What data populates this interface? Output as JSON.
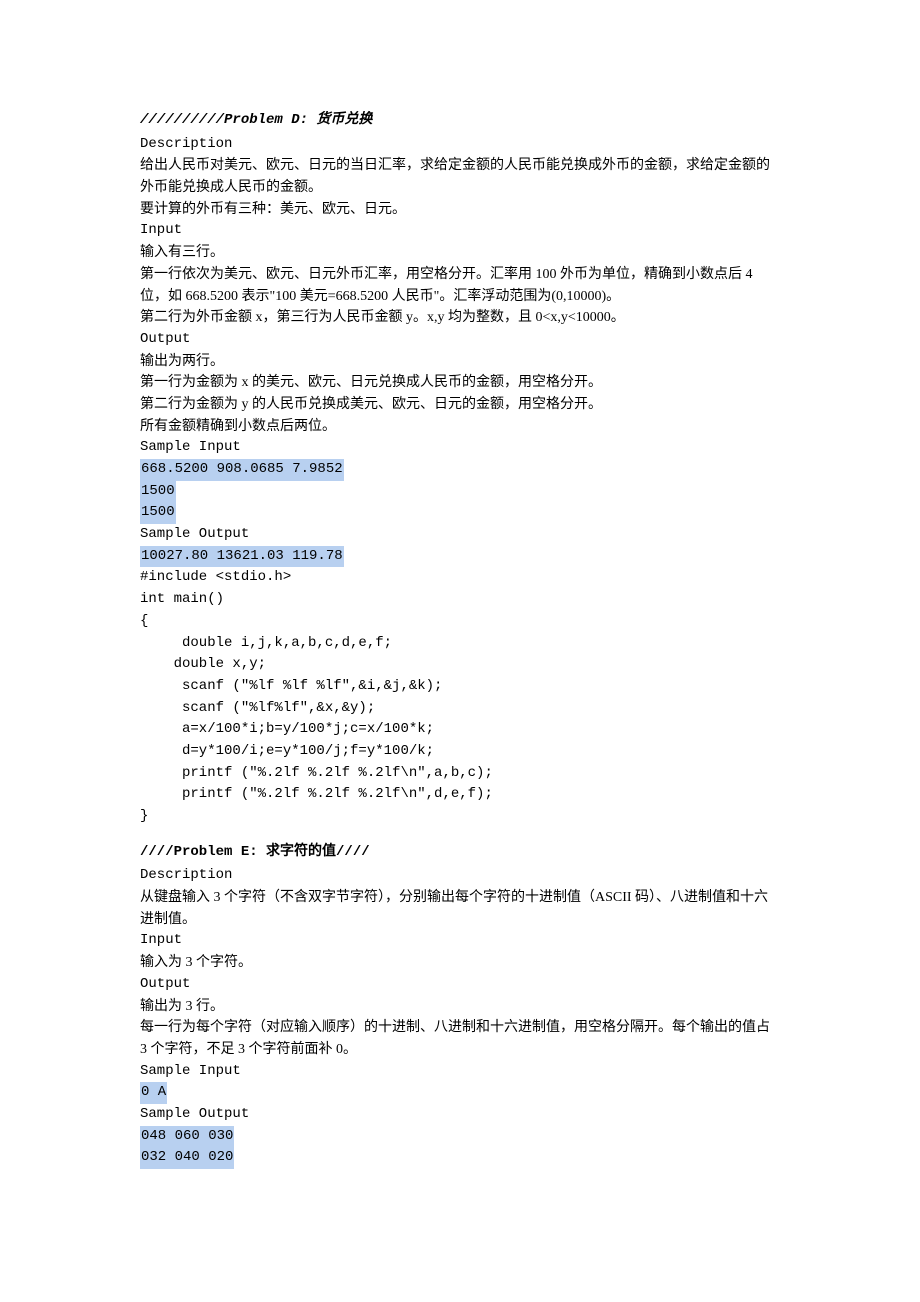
{
  "problem_d": {
    "title": "//////////Problem D: 货币兑换",
    "desc_label": "Description",
    "desc_p1": "给出人民币对美元、欧元、日元的当日汇率，求给定金额的人民币能兑换成外币的金额，求给定金额的外币能兑换成人民币的金额。",
    "desc_p2": "要计算的外币有三种：美元、欧元、日元。",
    "input_label": "Input",
    "input_p1": "输入有三行。",
    "input_p2": "第一行依次为美元、欧元、日元外币汇率，用空格分开。汇率用 100 外币为单位，精确到小数点后 4 位，如 668.5200 表示\"100 美元=668.5200 人民币\"。汇率浮动范围为(0,10000)。",
    "input_p3": "第二行为外币金额 x，第三行为人民币金额 y。x,y 均为整数，且 0<x,y<10000。",
    "output_label": "Output",
    "output_p1": "输出为两行。",
    "output_p2": "第一行为金额为 x 的美元、欧元、日元兑换成人民币的金额，用空格分开。",
    "output_p3": "第二行为金额为 y 的人民币兑换成美元、欧元、日元的金额，用空格分开。",
    "output_p4": "所有金额精确到小数点后两位。",
    "sample_input_label": "Sample Input",
    "sample_input_l1": "668.5200 908.0685 7.9852",
    "sample_input_l2": "1500",
    "sample_input_l3": "1500",
    "sample_output_label": "Sample Output",
    "sample_output_l1": "10027.80 13621.03 119.78",
    "code": "#include <stdio.h>\nint main()\n{\n     double i,j,k,a,b,c,d,e,f;\n    double x,y;\n     scanf (\"%lf %lf %lf\",&i,&j,&k);\n     scanf (\"%lf%lf\",&x,&y);\n     a=x/100*i;b=y/100*j;c=x/100*k;\n     d=y*100/i;e=y*100/j;f=y*100/k;\n     printf (\"%.2lf %.2lf %.2lf\\n\",a,b,c);\n     printf (\"%.2lf %.2lf %.2lf\\n\",d,e,f);\n}"
  },
  "problem_e": {
    "title": "////Problem E: 求字符的值////",
    "desc_label": "Description",
    "desc_p1": "从键盘输入 3 个字符（不含双字节字符），分别输出每个字符的十进制值（ASCII 码）、八进制值和十六进制值。",
    "input_label": "Input",
    "input_p1": "输入为 3 个字符。",
    "output_label": "Output",
    "output_p1": "输出为 3 行。",
    "output_p2": "每一行为每个字符（对应输入顺序）的十进制、八进制和十六进制值，用空格分隔开。每个输出的值占 3 个字符，不足 3 个字符前面补 0。",
    "sample_input_label": "Sample Input",
    "sample_input_l1": "0 A",
    "sample_output_label": "Sample Output",
    "sample_output_l1": "048 060 030",
    "sample_output_l2": "032 040 020"
  }
}
